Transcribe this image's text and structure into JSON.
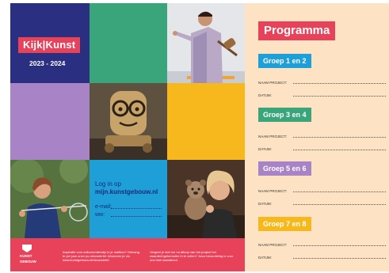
{
  "cover": {
    "brand": "Kijk|Kunst",
    "years": "2023 - 2024"
  },
  "login": {
    "title": "Log in op",
    "url": "mijn.kunstgebouw.nl",
    "email_label": "e-mail:",
    "password_label": "ww:"
  },
  "footer": {
    "logo_text_line1": "KUNST",
    "logo_text_line2": "GEBOUW",
    "text_left": "Inspiratie voor cultuuronderwijs in je mailbox? Ontvang te per jaar onze po-nieuwsbrief. Abonneer je via www.kunstgebouw.nl/nieuwsbrief.",
    "text_right": "Vergeet je niet om na afloop van het project het waarderingsformulier in te vullen? Jouw beoordeling is voor ons heel waardevol."
  },
  "programme": {
    "title": "Programma",
    "field_project": "NAAM PROJECT:",
    "field_date": "DATUM:",
    "groups": [
      {
        "label": "Groep 1 en 2",
        "color": "#1e9fd8"
      },
      {
        "label": "Groep 3 en 4",
        "color": "#3aa57a"
      },
      {
        "label": "Groep 5 en 6",
        "color": "#a883c6"
      },
      {
        "label": "Groep 7 en 8",
        "color": "#f6b81c"
      }
    ]
  },
  "colors": {
    "navy": "#2b2f82",
    "red": "#e8415a",
    "green": "#3aa57a",
    "purple": "#a883c6",
    "yellow": "#f6b81c",
    "blue": "#1e9fd8",
    "panel": "#fde3c3"
  }
}
